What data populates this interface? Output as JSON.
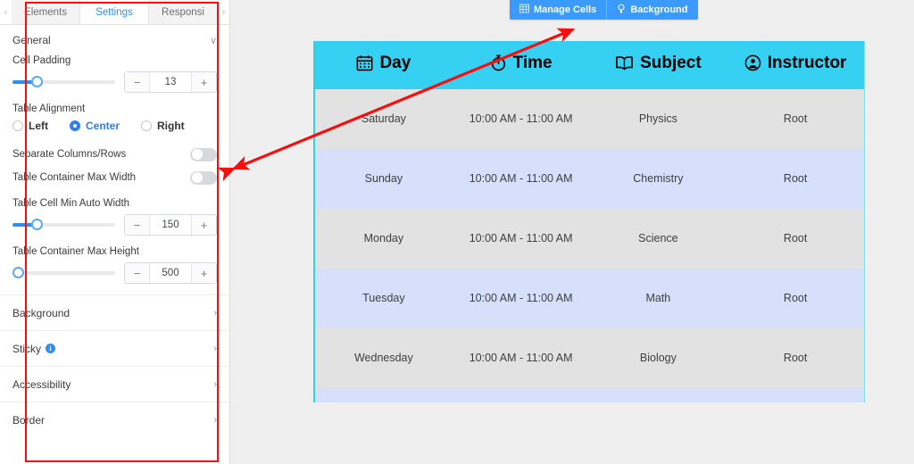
{
  "sidebar": {
    "tabs": [
      {
        "label": "Elements",
        "active": false
      },
      {
        "label": "Settings",
        "active": true
      },
      {
        "label": "Responsi",
        "active": false
      }
    ],
    "prev_arrow": "‹",
    "next_arrow": "›",
    "general": {
      "title": "General",
      "chevron": "∨"
    },
    "cell_padding": {
      "label": "Cell Padding",
      "value": "13",
      "minus": "−",
      "plus": "+",
      "fill_percent": 22
    },
    "table_alignment": {
      "label": "Table Alignment",
      "options": [
        {
          "label": "Left",
          "selected": false
        },
        {
          "label": "Center",
          "selected": true
        },
        {
          "label": "Right",
          "selected": false
        }
      ]
    },
    "separate_columns_rows": {
      "label": "Separate Columns/Rows",
      "on": false
    },
    "table_container_max_width": {
      "label": "Table Container Max Width",
      "on": false
    },
    "table_cell_min_auto_width": {
      "label": "Table Cell Min Auto Width",
      "value": "150",
      "minus": "−",
      "plus": "+",
      "fill_percent": 22
    },
    "table_container_max_height": {
      "label": "Table Container Max Height",
      "value": "500",
      "minus": "−",
      "plus": "+",
      "fill_percent": 0
    },
    "accordion": [
      {
        "label": "Background",
        "chevron": "›",
        "info": false
      },
      {
        "label": "Sticky",
        "chevron": "›",
        "info": true,
        "info_glyph": "i"
      },
      {
        "label": "Accessibility",
        "chevron": "›",
        "info": false
      },
      {
        "label": "Border",
        "chevron": "›",
        "info": false
      }
    ]
  },
  "toolbar": {
    "manage_cells_label": "Manage Cells",
    "background_label": "Background"
  },
  "table": {
    "header_bg": "#35d0f2",
    "row_odd_bg": "#e2e2e2",
    "row_even_bg": "#d7e0fb",
    "columns": [
      {
        "label": "Day",
        "icon": "calendar-icon"
      },
      {
        "label": "Time",
        "icon": "stopwatch-icon"
      },
      {
        "label": "Subject",
        "icon": "book-icon"
      },
      {
        "label": "Instructor",
        "icon": "user-circle-icon"
      }
    ],
    "rows": [
      {
        "day": "Saturday",
        "time": "10:00 AM - 11:00 AM",
        "subject": "Physics",
        "instructor": "Root"
      },
      {
        "day": "Sunday",
        "time": "10:00 AM - 11:00 AM",
        "subject": "Chemistry",
        "instructor": "Root"
      },
      {
        "day": "Monday",
        "time": "10:00 AM - 11:00 AM",
        "subject": "Science",
        "instructor": "Root"
      },
      {
        "day": "Tuesday",
        "time": "10:00 AM - 11:00 AM",
        "subject": "Math",
        "instructor": "Root"
      },
      {
        "day": "Wednesday",
        "time": "10:00 AM - 11:00 AM",
        "subject": "Biology",
        "instructor": "Root"
      }
    ]
  },
  "annotation": {
    "arrow_color": "#fb0d0d",
    "highlight_color": "#fb0d0d"
  }
}
